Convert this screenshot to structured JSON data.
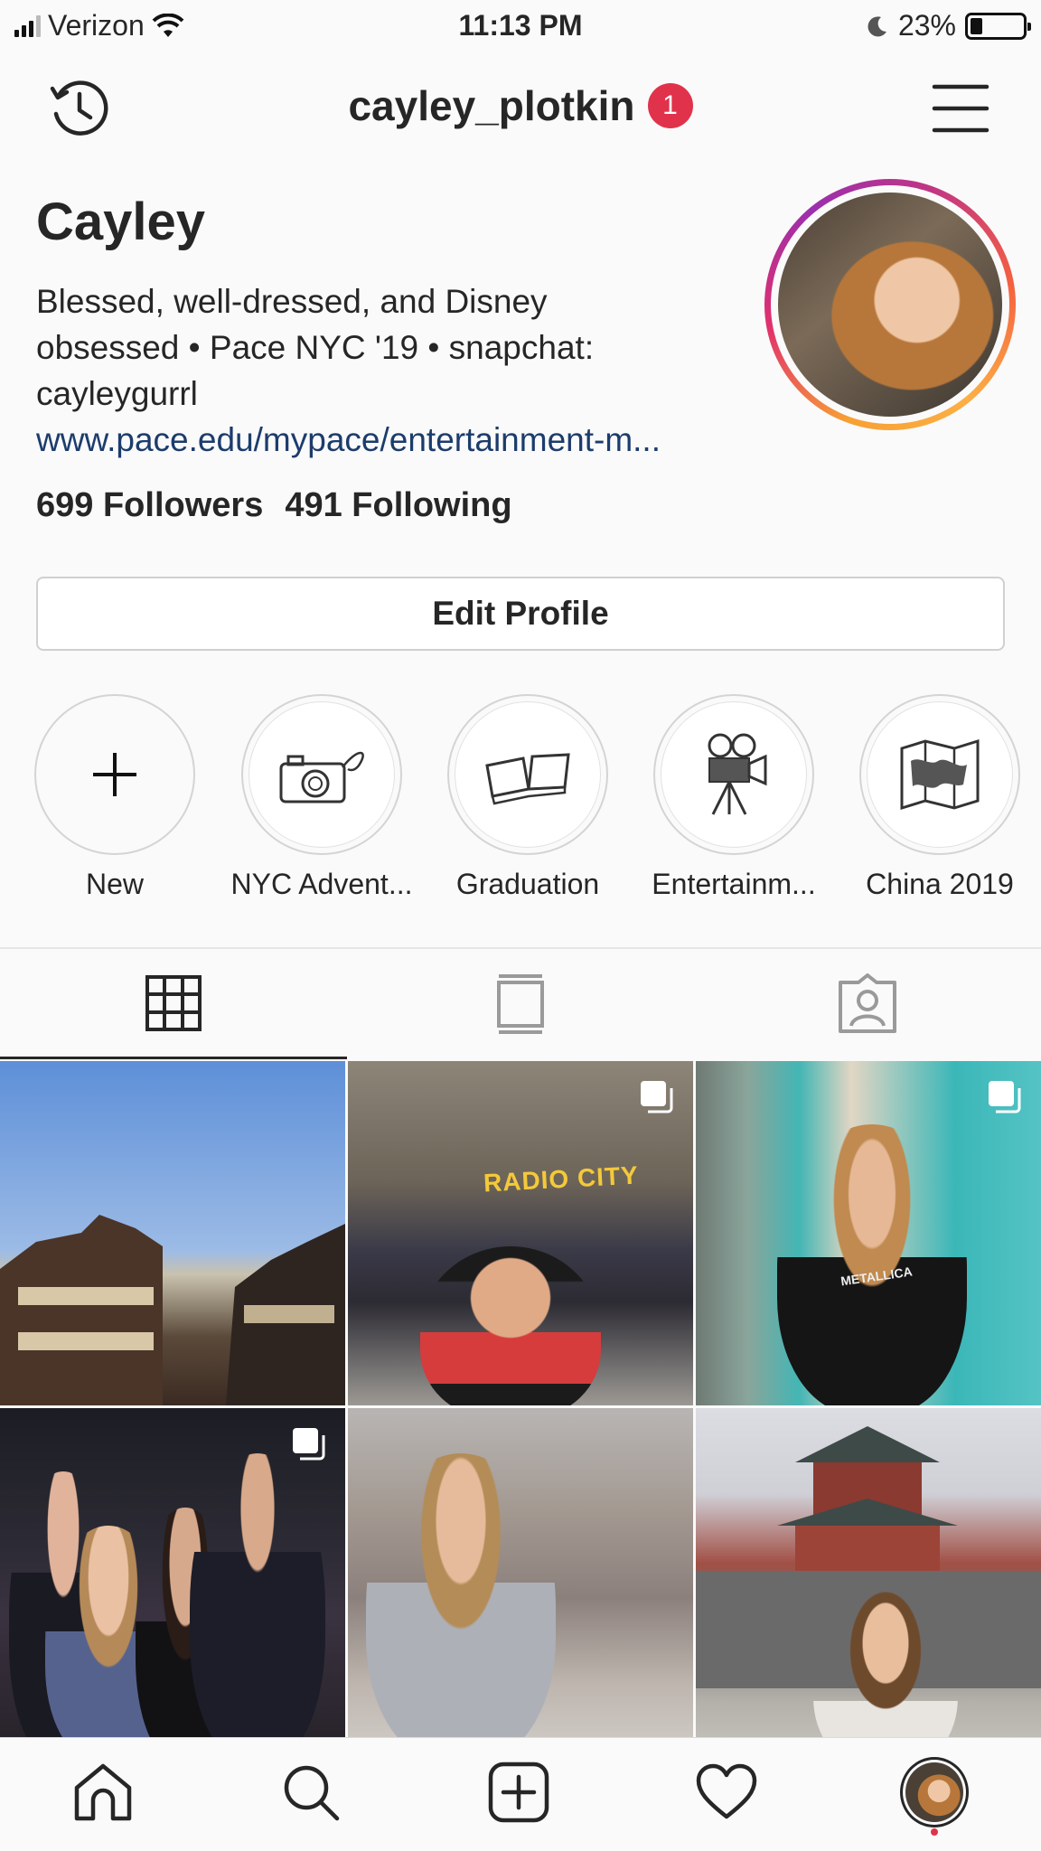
{
  "status_bar": {
    "carrier": "Verizon",
    "time": "11:13 PM",
    "battery": "23%",
    "battery_level": 0.23
  },
  "header": {
    "username": "cayley_plotkin",
    "notification_count": "1"
  },
  "profile": {
    "name": "Cayley",
    "bio_line1": "Blessed, well-dressed, and Disney",
    "bio_line2": "obsessed • Pace NYC '19 • snapchat:",
    "bio_line3": "cayleygurrl",
    "link": "www.pace.edu/mypace/entertainment-m...",
    "followers": "699 Followers",
    "following": "491 Following",
    "edit_button": "Edit Profile"
  },
  "highlights": [
    {
      "label": "New",
      "icon": "plus-icon"
    },
    {
      "label": "NYC Advent...",
      "icon": "camera-icon"
    },
    {
      "label": "Graduation",
      "icon": "book-icon"
    },
    {
      "label": "Entertainm...",
      "icon": "movie-camera-icon"
    },
    {
      "label": "China 2019",
      "icon": "map-icon"
    }
  ],
  "tabs": [
    {
      "name": "grid",
      "icon": "grid-icon",
      "active": true
    },
    {
      "name": "feed",
      "icon": "feed-icon",
      "active": false
    },
    {
      "name": "tagged",
      "icon": "tagged-user-icon",
      "active": false
    }
  ],
  "posts": [
    {
      "multi": false
    },
    {
      "multi": true,
      "sign": "RADIO CITY"
    },
    {
      "multi": true,
      "shirt": "METALLICA"
    },
    {
      "multi": true
    },
    {
      "multi": false
    },
    {
      "multi": false
    }
  ],
  "bottom_nav": [
    "home-icon",
    "search-icon",
    "add-post-icon",
    "heart-icon",
    "profile-avatar"
  ],
  "colors": {
    "badge": "#e0334b",
    "link": "#1c3c6c",
    "story_ring": [
      "#f7a034",
      "#e1306c",
      "#9b2fae"
    ]
  }
}
